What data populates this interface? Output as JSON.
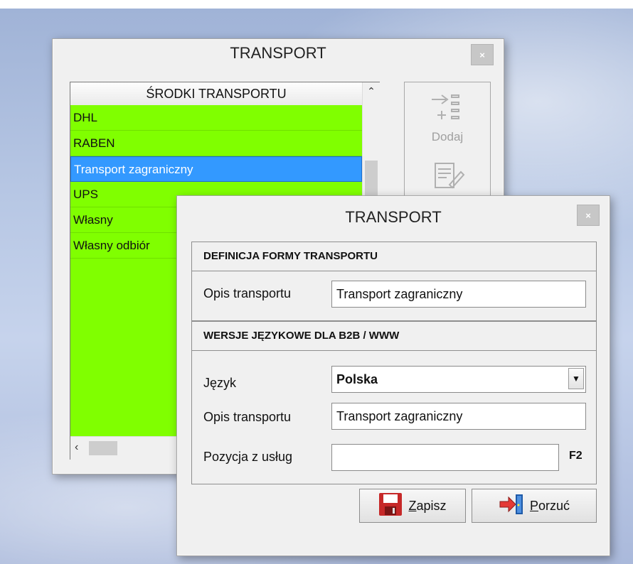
{
  "back_window": {
    "title": "TRANSPORT",
    "close": "×",
    "list_header": "ŚRODKI TRANSPORTU",
    "items": [
      "DHL",
      "RABEN",
      "Transport zagraniczny",
      "UPS",
      "Własny",
      "Własny odbiór"
    ],
    "selected_index": 2,
    "side_buttons": {
      "add_label": "Dodaj"
    }
  },
  "dialog": {
    "title": "TRANSPORT",
    "close": "×",
    "section1": {
      "title": "DEFINICJA FORMY TRANSPORTU",
      "opis_label": "Opis transportu",
      "opis_value": "Transport zagraniczny"
    },
    "section2": {
      "title": "WERSJE JĘZYKOWE DLA  B2B / WWW",
      "jezyk_label": "Język",
      "jezyk_value": "Polska",
      "opis_label": "Opis transportu",
      "opis_value": "Transport zagraniczny",
      "pozycja_label": "Pozycja z usług",
      "pozycja_value": "",
      "f2": "F2"
    },
    "buttons": {
      "save_label_first": "Z",
      "save_label_rest": "apisz",
      "cancel_label_first": "P",
      "cancel_label_rest": "orzuć"
    }
  },
  "colors": {
    "list_bg": "#80ff00",
    "selection": "#3399ff"
  }
}
